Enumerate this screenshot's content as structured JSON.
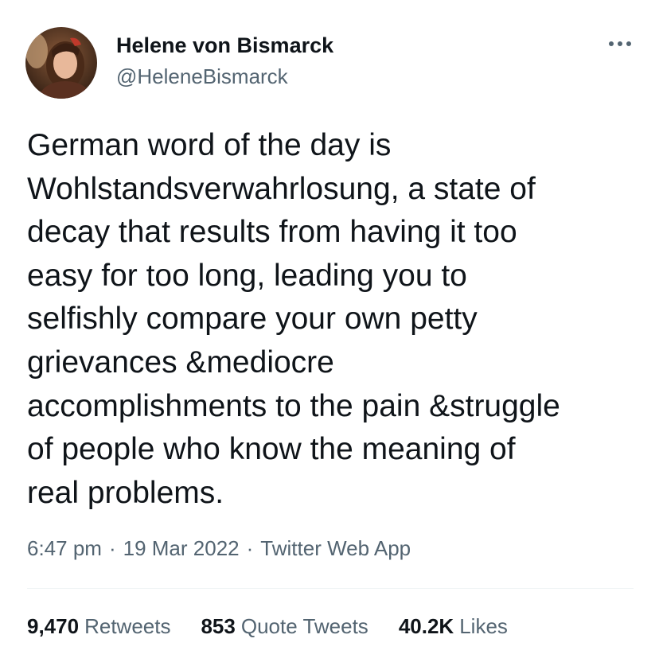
{
  "author": {
    "display_name": "Helene von Bismarck",
    "handle": "@HeleneBismarck"
  },
  "tweet": {
    "text_lines": [
      "German word of the day is",
      "Wohlstandsverwahrlosung, a state of",
      "decay that results from having it too",
      "easy for too long, leading you to",
      "selfishly compare your own petty",
      "grievances &mediocre",
      "accomplishments to the pain &struggle",
      "of people who know the meaning of",
      "real problems."
    ],
    "time": "6:47 pm",
    "date": "19 Mar 2022",
    "source": "Twitter Web App",
    "separator": "·"
  },
  "stats": {
    "retweets": {
      "count": "9,470",
      "label": "Retweets"
    },
    "quotes": {
      "count": "853",
      "label": "Quote Tweets"
    },
    "likes": {
      "count": "40.2K",
      "label": "Likes"
    }
  },
  "icons": {
    "more": "more-horizontal-icon"
  },
  "colors": {
    "text_primary": "#0f1419",
    "text_secondary": "#536471",
    "divider": "#eff3f4"
  }
}
